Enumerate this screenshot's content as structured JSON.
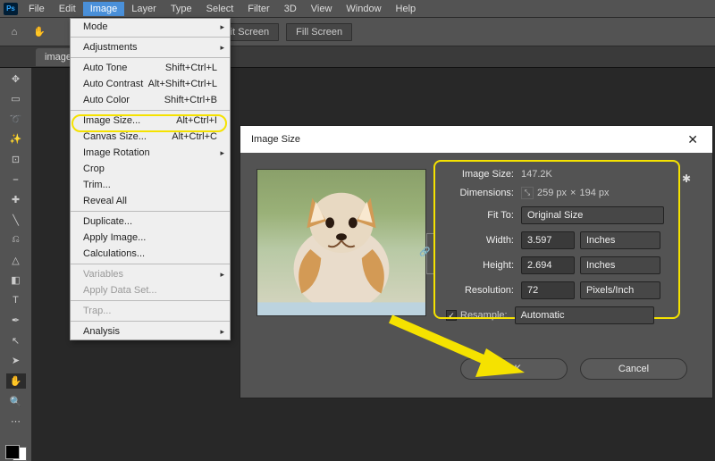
{
  "menubar": {
    "items": [
      "File",
      "Edit",
      "Image",
      "Layer",
      "Type",
      "Select",
      "Filter",
      "3D",
      "View",
      "Window",
      "Help"
    ],
    "selected_index": 2
  },
  "optbar": {
    "fit_screen": "Fit Screen",
    "fill_screen": "Fill Screen"
  },
  "tab": {
    "label": "images."
  },
  "dropdown": {
    "groups": [
      [
        {
          "label": "Mode",
          "arrow": true
        }
      ],
      [
        {
          "label": "Adjustments",
          "arrow": true
        }
      ],
      [
        {
          "label": "Auto Tone",
          "shortcut": "Shift+Ctrl+L"
        },
        {
          "label": "Auto Contrast",
          "shortcut": "Alt+Shift+Ctrl+L"
        },
        {
          "label": "Auto Color",
          "shortcut": "Shift+Ctrl+B"
        }
      ],
      [
        {
          "label": "Image Size...",
          "shortcut": "Alt+Ctrl+I"
        },
        {
          "label": "Canvas Size...",
          "shortcut": "Alt+Ctrl+C"
        },
        {
          "label": "Image Rotation",
          "arrow": true
        },
        {
          "label": "Crop"
        },
        {
          "label": "Trim..."
        },
        {
          "label": "Reveal All"
        }
      ],
      [
        {
          "label": "Duplicate..."
        },
        {
          "label": "Apply Image..."
        },
        {
          "label": "Calculations..."
        }
      ],
      [
        {
          "label": "Variables",
          "arrow": true,
          "disabled": true
        },
        {
          "label": "Apply Data Set...",
          "disabled": true
        }
      ],
      [
        {
          "label": "Trap...",
          "disabled": true
        }
      ],
      [
        {
          "label": "Analysis",
          "arrow": true
        }
      ]
    ]
  },
  "dialog": {
    "title": "Image Size",
    "close_glyph": "✕",
    "image_size_label": "Image Size:",
    "image_size_value": "147.2K",
    "dimensions_label": "Dimensions:",
    "dimensions_value_a": "259 px",
    "dimensions_sep": "×",
    "dimensions_value_b": "194 px",
    "fit_to_label": "Fit To:",
    "fit_to_value": "Original Size",
    "width_label": "Width:",
    "width_value": "3.597",
    "width_unit": "Inches",
    "height_label": "Height:",
    "height_value": "2.694",
    "height_unit": "Inches",
    "resolution_label": "Resolution:",
    "resolution_value": "72",
    "resolution_unit": "Pixels/Inch",
    "resample_label": "Resample:",
    "resample_value": "Automatic",
    "ok": "OK",
    "cancel": "Cancel",
    "gear_glyph": "✱",
    "check_glyph": "✓",
    "link_glyph": "🔗",
    "dim_glyph": "⤡"
  },
  "icons": {
    "home": "⌂",
    "hand": "✋",
    "move": "✥",
    "marquee": "▭",
    "lasso": "➰",
    "wand": "✨",
    "crop": "⊡",
    "eyedrop": "⎯",
    "heal": "✚",
    "brush": "╲",
    "stamp": "⎌",
    "eraser": "△",
    "gradient": "◧",
    "type": "T",
    "pen": "✒",
    "path": "↖",
    "arrow": "➤",
    "handtool": "✋",
    "zoom": "🔍",
    "more": "⋯"
  }
}
